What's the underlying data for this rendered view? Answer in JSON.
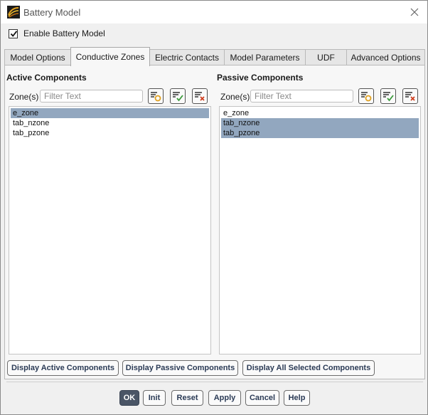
{
  "window": {
    "title": "Battery Model"
  },
  "enable": {
    "label": "Enable Battery Model",
    "checked": true
  },
  "tabs": [
    {
      "label": "Model Options",
      "active": false
    },
    {
      "label": "Conductive Zones",
      "active": true
    },
    {
      "label": "Electric Contacts",
      "active": false
    },
    {
      "label": "Model Parameters",
      "active": false
    },
    {
      "label": "UDF",
      "active": false
    },
    {
      "label": "Advanced Options",
      "active": false
    }
  ],
  "active_components": {
    "title": "Active Components",
    "zone_label": "Zone(s)",
    "filter_placeholder": "Filter Text",
    "items": [
      {
        "label": "e_zone",
        "selected": true
      },
      {
        "label": "tab_nzone",
        "selected": false
      },
      {
        "label": "tab_pzone",
        "selected": false
      }
    ]
  },
  "passive_components": {
    "title": "Passive Components",
    "zone_label": "Zone(s)",
    "filter_placeholder": "Filter Text",
    "items": [
      {
        "label": "e_zone",
        "selected": false
      },
      {
        "label": "tab_nzone",
        "selected": true
      },
      {
        "label": "tab_pzone",
        "selected": true
      }
    ]
  },
  "display_buttons": {
    "active": "Display Active Components",
    "passive": "Display Passive Components",
    "all": "Display All Selected Components"
  },
  "actions": {
    "ok": "OK",
    "init": "Init",
    "reset": "Reset",
    "apply": "Apply",
    "cancel": "Cancel",
    "help": "Help"
  },
  "colors": {
    "selection": "#92a7bf",
    "primary_button": "#4a5566",
    "icon_accent": "#e0a020",
    "icon_check": "#3a9a3a",
    "icon_clear": "#d04020"
  },
  "icons": {
    "app": "battery-model-icon",
    "close": "close-icon",
    "select_none_zones": "filter-settings-icon",
    "select_all_zones": "select-all-icon",
    "deselect_all_zones": "deselect-all-icon"
  }
}
